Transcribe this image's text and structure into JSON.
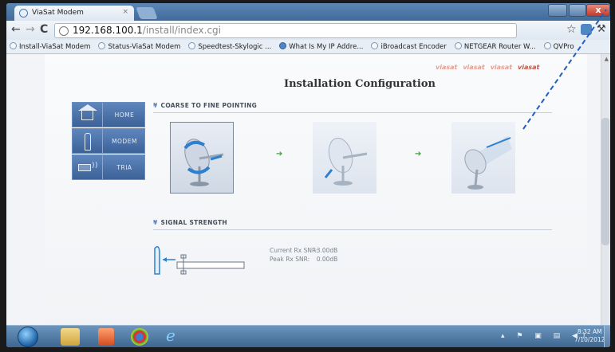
{
  "browser": {
    "tab_title": "ViaSat Modem",
    "tab_close": "×",
    "url_host": "192.168.100.1",
    "url_path": "/install/index.cgi",
    "window_close": "x"
  },
  "bookmarks": [
    {
      "label": "Install-ViaSat Modem",
      "icon": "globe-icon"
    },
    {
      "label": "Status-ViaSat Modem",
      "icon": "globe-icon"
    },
    {
      "label": "Speedtest-Skylogic ...",
      "icon": "globe-icon"
    },
    {
      "label": "What Is My IP Addre...",
      "icon": "youtube-icon"
    },
    {
      "label": "iBroadcast Encoder",
      "icon": "globe-icon"
    },
    {
      "label": "NETGEAR Router W...",
      "icon": "globe-icon"
    },
    {
      "label": "QVPro",
      "icon": "globe-icon"
    }
  ],
  "page": {
    "title": "Installation Configuration",
    "logos": [
      "viasat",
      "viasat",
      "viasat",
      "viasat"
    ]
  },
  "nav": {
    "home": "HOME",
    "modem": "MODEM",
    "tria": "TRIA"
  },
  "sections": {
    "coarse": "COARSE TO FINE POINTING",
    "signal": "SIGNAL STRENGTH"
  },
  "signal": {
    "current_label": "Current Rx SNR:",
    "peak_label": "Peak Rx SNR:",
    "current_value": "-3.00dB",
    "peak_value": "0.00dB"
  },
  "taskbar": {
    "time": "8:32 AM",
    "date": "7/10/2012"
  },
  "colors": {
    "nav_blue": "#4a72a8",
    "arrow_green": "#48a048",
    "dash_line": "#1f5fbf"
  }
}
